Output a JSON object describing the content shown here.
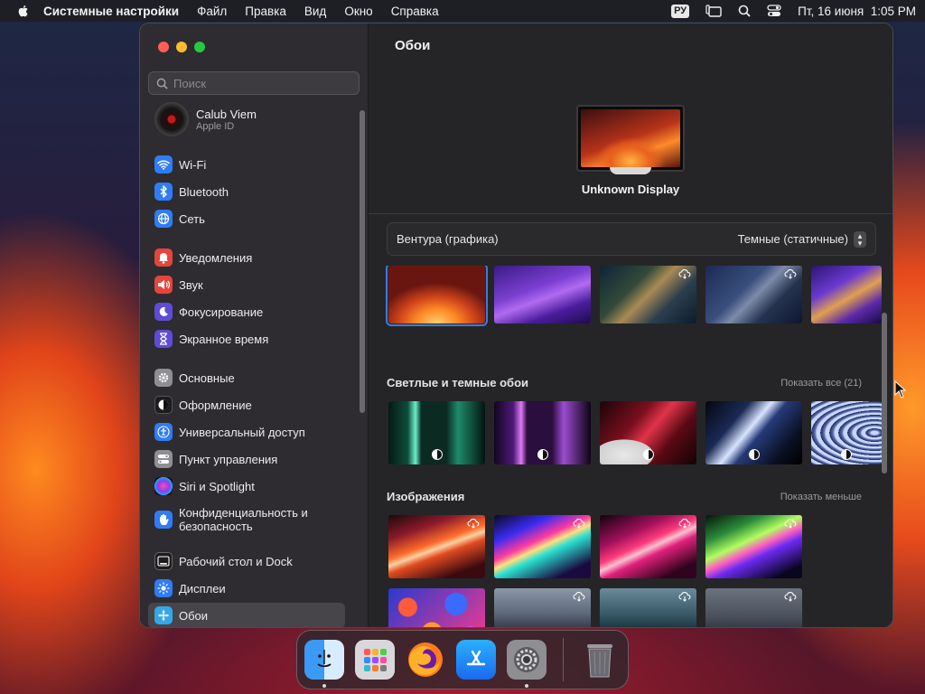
{
  "menubar": {
    "app_name": "Системные настройки",
    "menus": [
      "Файл",
      "Правка",
      "Вид",
      "Окно",
      "Справка"
    ],
    "input_source": "РУ",
    "datetime": "Пт, 16 июня  1:05 PM"
  },
  "sidebar": {
    "search_placeholder": "Поиск",
    "account": {
      "name": "Calub Viem",
      "subtitle": "Apple ID"
    },
    "items": [
      {
        "label": "Wi-Fi",
        "icon": "wifi-icon",
        "color": "#2f7cf6"
      },
      {
        "label": "Bluetooth",
        "icon": "bluetooth-icon",
        "color": "#2f7cf6"
      },
      {
        "label": "Сеть",
        "icon": "globe-icon",
        "color": "#2f7cf6"
      },
      {
        "label": "Уведомления",
        "icon": "bell-icon",
        "color": "#e5453a"
      },
      {
        "label": "Звук",
        "icon": "speaker-icon",
        "color": "#e5453a"
      },
      {
        "label": "Фокусирование",
        "icon": "moon-icon",
        "color": "#5e4bd6"
      },
      {
        "label": "Экранное время",
        "icon": "hourglass-icon",
        "color": "#5e4bd6"
      },
      {
        "label": "Основные",
        "icon": "gear-icon",
        "color": "#8e8e93"
      },
      {
        "label": "Оформление",
        "icon": "appearance-icon",
        "color": "#1c1c1e"
      },
      {
        "label": "Универсальный доступ",
        "icon": "accessibility-icon",
        "color": "#2f7cf6"
      },
      {
        "label": "Пункт управления",
        "icon": "toggles-icon",
        "color": "#8e8e93"
      },
      {
        "label": "Siri и Spotlight",
        "icon": "siri-icon",
        "color": "#1c1c1e"
      },
      {
        "label": "Конфиденциальность и безопасность",
        "icon": "hand-icon",
        "color": "#2f7cf6"
      },
      {
        "label": "Рабочий стол и Dock",
        "icon": "dock-icon",
        "color": "#1c1c1e"
      },
      {
        "label": "Дисплеи",
        "icon": "sun-icon",
        "color": "#2f7cf6"
      },
      {
        "label": "Обои",
        "icon": "wallpaper-icon",
        "color": "#35a7e8"
      }
    ],
    "selected_label": "Обои"
  },
  "content": {
    "title": "Обои",
    "display_name": "Unknown Display",
    "wallpaper_name": "Вентура (графика)",
    "wallpaper_style": "Темные (статичные)",
    "sections": [
      {
        "title": "Светлые и темные обои",
        "link": "Показать все (21)"
      },
      {
        "title": "Изображения",
        "link": "Показать меньше"
      }
    ]
  },
  "dock": {
    "apps": [
      "finder-icon",
      "launchpad-icon",
      "firefox-icon",
      "app-store-icon",
      "system-settings-icon",
      "trash-icon"
    ]
  }
}
